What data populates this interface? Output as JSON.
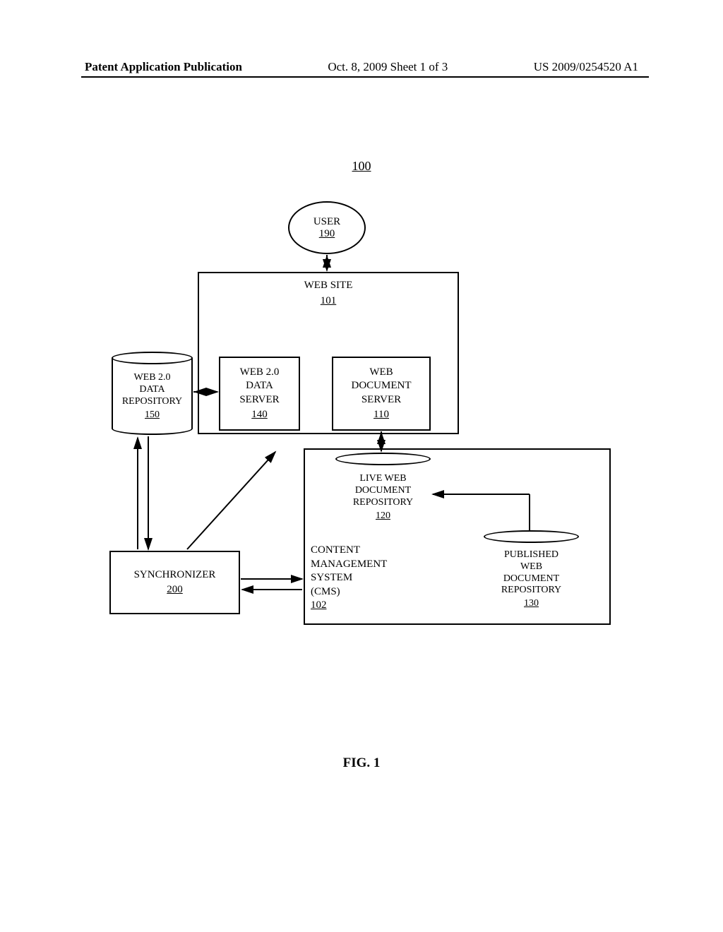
{
  "header": {
    "left": "Patent Application Publication",
    "center": "Oct. 8, 2009  Sheet 1 of 3",
    "right": "US 2009/0254520 A1"
  },
  "figure": {
    "system_ref": "100",
    "caption": "FIG. 1"
  },
  "nodes": {
    "user": {
      "label": "USER",
      "ref": "190"
    },
    "website": {
      "label": "WEB SITE",
      "ref": "101"
    },
    "web20_repo": {
      "line1": "WEB 2.0",
      "line2": "DATA",
      "line3": "REPOSITORY",
      "ref": "150"
    },
    "web20_server": {
      "line1": "WEB 2.0",
      "line2": "DATA",
      "line3": "SERVER",
      "ref": "140"
    },
    "web_doc_server": {
      "line1": "WEB",
      "line2": "DOCUMENT",
      "line3": "SERVER",
      "ref": "110"
    },
    "live_repo": {
      "line1": "LIVE WEB",
      "line2": "DOCUMENT",
      "line3": "REPOSITORY",
      "ref": "120"
    },
    "pub_repo": {
      "line1": "PUBLISHED",
      "line2": "WEB",
      "line3": "DOCUMENT",
      "line4": "REPOSITORY",
      "ref": "130"
    },
    "cms": {
      "line1": "CONTENT",
      "line2": "MANAGEMENT",
      "line3": "SYSTEM",
      "line4": "(CMS)",
      "ref": "102"
    },
    "sync": {
      "label": "SYNCHRONIZER",
      "ref": "200"
    }
  }
}
